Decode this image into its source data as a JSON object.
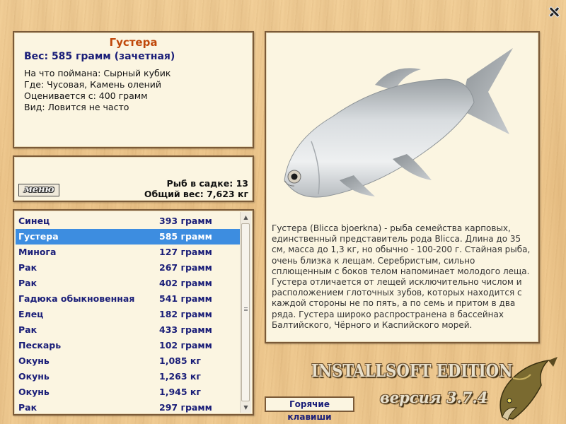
{
  "fish_info": {
    "name": "Густера",
    "weight_line": "Вес: 585 грамм (зачетная)",
    "caught_on": "На что поймана: Сырный кубик",
    "location": "Где: Чусовая, Камень олений",
    "valued_from": "Оценивается с: 400 грамм",
    "frequency": "Вид: Ловится не часто"
  },
  "status": {
    "menu_label": "меню",
    "fish_count": "Рыб в садке: 13",
    "total_weight": "Общий вес: 7,623 кг"
  },
  "catch_list": [
    {
      "name": "Синец",
      "weight": "393 грамм",
      "selected": false
    },
    {
      "name": "Густера",
      "weight": "585 грамм",
      "selected": true
    },
    {
      "name": "Минога",
      "weight": "127 грамм",
      "selected": false
    },
    {
      "name": "Рак",
      "weight": "267 грамм",
      "selected": false
    },
    {
      "name": "Рак",
      "weight": "402 грамм",
      "selected": false
    },
    {
      "name": "Гадюка обыкновенная",
      "weight": "541 грамм",
      "selected": false
    },
    {
      "name": "Елец",
      "weight": "182 грамм",
      "selected": false
    },
    {
      "name": "Рак",
      "weight": "433 грамм",
      "selected": false
    },
    {
      "name": "Пескарь",
      "weight": "102 грамм",
      "selected": false
    },
    {
      "name": "Окунь",
      "weight": "1,085 кг",
      "selected": false
    },
    {
      "name": "Окунь",
      "weight": "1,263 кг",
      "selected": false
    },
    {
      "name": "Окунь",
      "weight": "1,945 кг",
      "selected": false
    },
    {
      "name": "Рак",
      "weight": "297 грамм",
      "selected": false
    }
  ],
  "description": "Густера (Blicca bjoerkna) - рыба семейства карповых, единственный представитель рода Blicca. Длина до 35 см, масса до 1,3 кг, но обычно - 100-200 г. Стайная рыба, очень близка к лещам. Серебристым, сильно сплющенным с боков телом напоминает молодого леща. Густера отличается от лещей исключительно числом и расположением глоточных зубов, которых находится с каждой стороны не по пять, а по семь и притом в два ряда. Густера широко распространена в бассейнах Балтийского, Чёрного и Каспийского морей.",
  "hotkeys_label": "Горячие клавиши",
  "branding": {
    "edition": "INSTALLSOFT EDITION",
    "version": "версия 3.7.4"
  },
  "colors": {
    "accent_title": "#c0480a",
    "list_text": "#1a1e78",
    "selection": "#3d8de0"
  }
}
